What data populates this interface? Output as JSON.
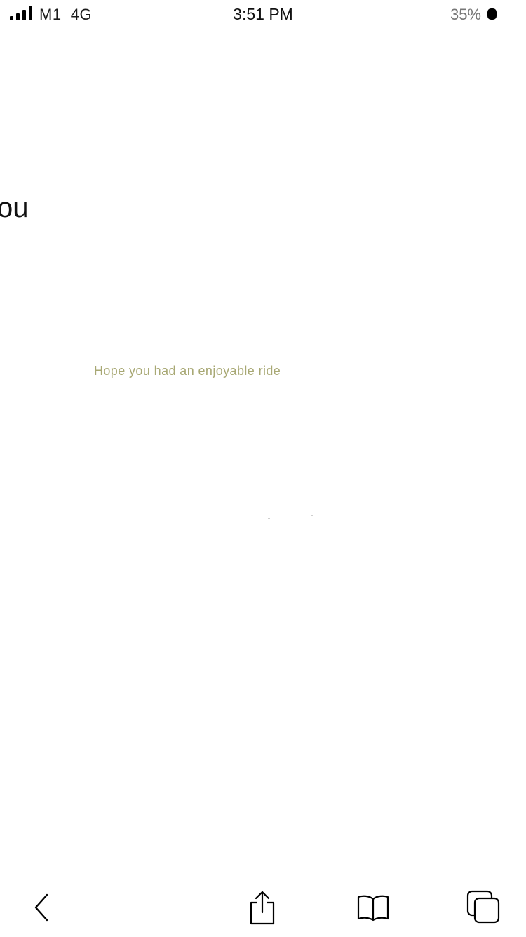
{
  "status_bar": {
    "carrier": "M1  4G",
    "time": "3:51 PM",
    "battery": "35%"
  },
  "page": {
    "heading_fragment": "ou",
    "message": "Hope you had an enjoyable ride"
  },
  "toolbar": {
    "icons": [
      "back-icon",
      "share-icon",
      "bookmarks-icon",
      "tabs-icon"
    ]
  }
}
